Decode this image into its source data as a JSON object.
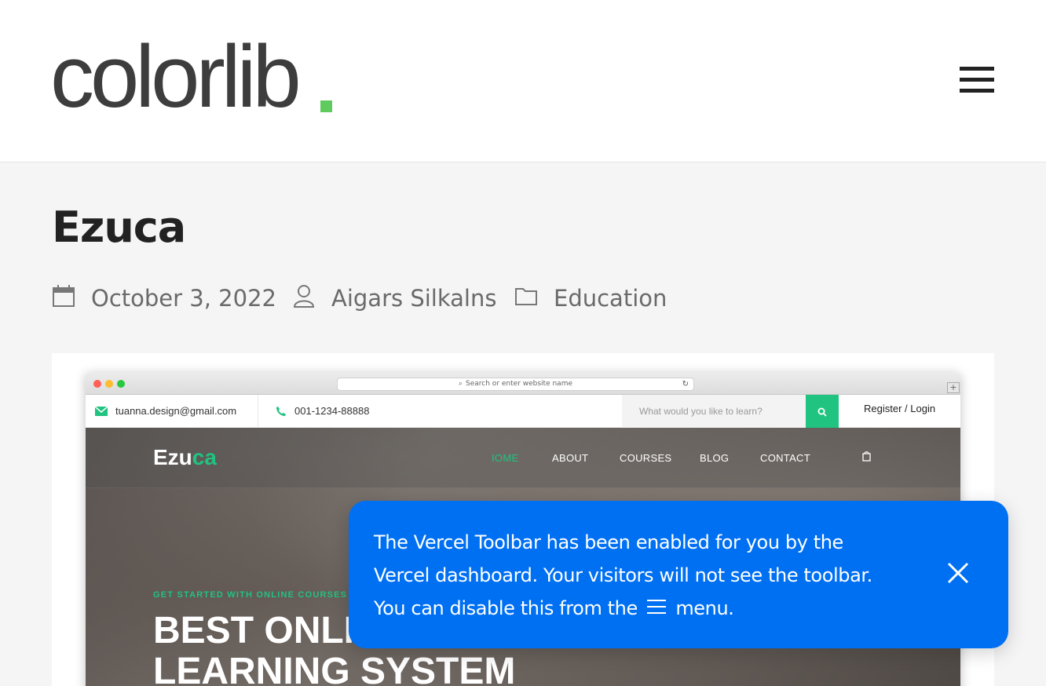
{
  "site": {
    "logo_text": "colorlib",
    "logo_dot_color": "#5fcb5f"
  },
  "post": {
    "title": "Ezuca",
    "date": "October 3, 2022",
    "author": "Aigars Silkalns",
    "category": "Education"
  },
  "screenshot": {
    "address_placeholder": "Search or enter website name",
    "email": "tuanna.design@gmail.com",
    "phone": "001-1234-88888",
    "search_placeholder": "What would you like to learn?",
    "register": "Register",
    "separator": "/",
    "login": "Login",
    "logo_main": "Ezu",
    "logo_accent": "ca",
    "nav": [
      "IOME",
      "ABOUT",
      "COURSES",
      "BLOG",
      "CONTACT"
    ],
    "kicker": "GET STARTED WITH ONLINE COURSES",
    "headline_line1": "BEST ONLI",
    "headline_line2": "LEARNING SYSTEM",
    "accent_color": "#20c380"
  },
  "toast": {
    "line1": "The Vercel Toolbar has been enabled for you by the",
    "line2": "Vercel dashboard. Your visitors will not see the toolbar.",
    "line3_before": "You can disable this from the",
    "line3_after": "menu.",
    "background": "#0070f3"
  },
  "icons": {
    "hamburger": "hamburger-menu-icon",
    "calendar": "calendar-icon",
    "user": "user-icon",
    "folder": "folder-icon",
    "close": "close-icon"
  }
}
